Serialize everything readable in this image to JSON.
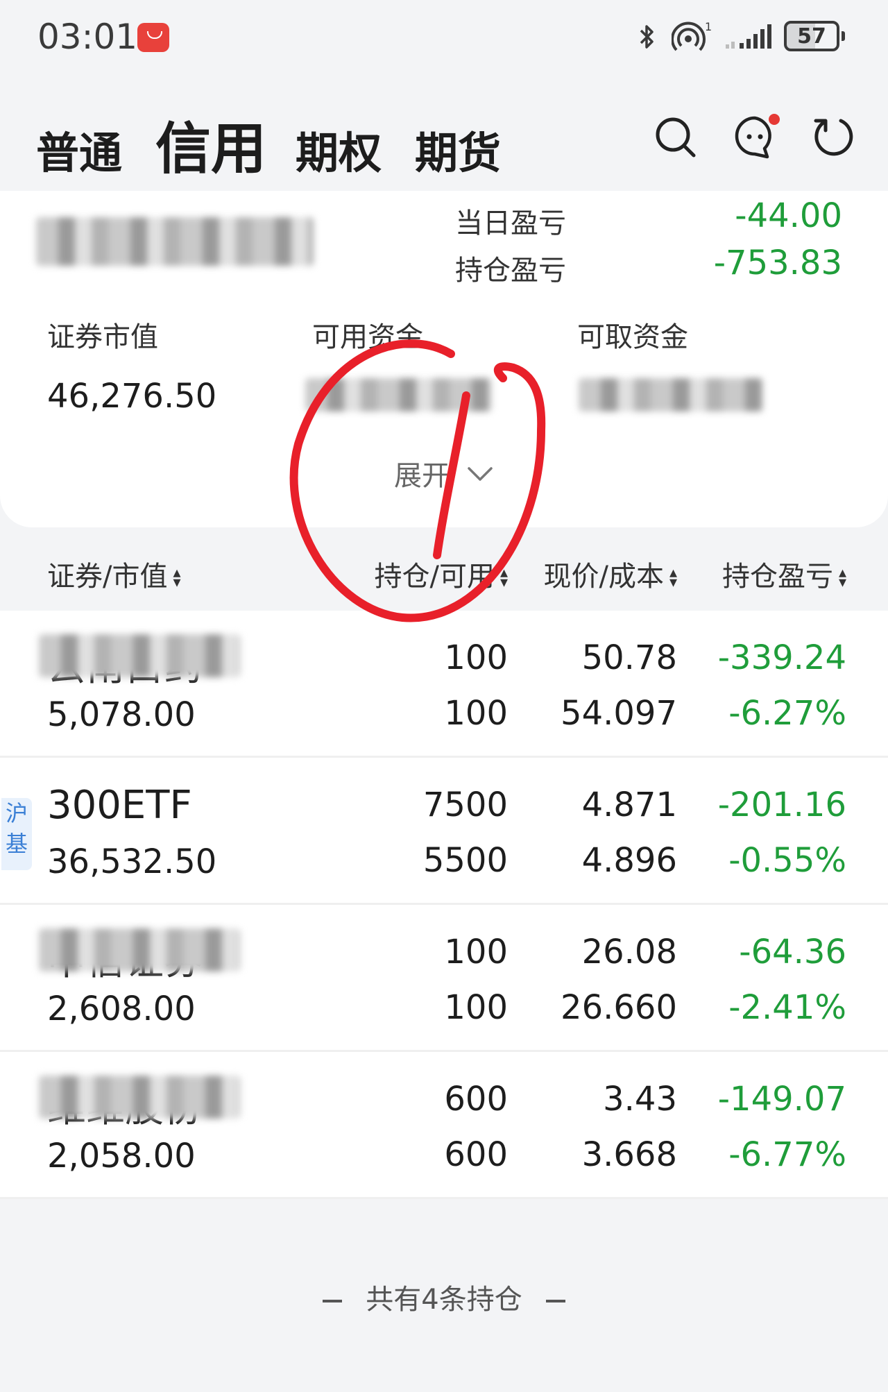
{
  "status_bar": {
    "time": "03:01",
    "battery": "57",
    "battery_level": 0.57
  },
  "nav": {
    "tabs": [
      {
        "label": "普通"
      },
      {
        "label": "信用"
      },
      {
        "label": "期权"
      },
      {
        "label": "期货"
      }
    ],
    "active_tab": "信用",
    "notification_dot_color": "#e53935"
  },
  "summary": {
    "day_pl_label": "当日盈亏",
    "day_pl_value": "-44.00",
    "hold_pl_label": "持仓盈亏",
    "hold_pl_value": "-753.83",
    "market_value_label": "证券市值",
    "market_value": "46,276.50",
    "available_cash_label": "可用资金",
    "withdrawable_cash_label": "可取资金",
    "expand_label": "展开"
  },
  "table": {
    "headers": [
      "证券/市值",
      "持仓/可用",
      "现价/成本",
      "持仓盈亏"
    ],
    "rows": [
      {
        "name": "云南白药",
        "name_blurred": true,
        "market_value": "5,078.00",
        "position": "100",
        "available": "100",
        "price": "50.78",
        "cost": "54.097",
        "pl": "-339.24",
        "pl_pct": "-6.27%"
      },
      {
        "name": "300ETF",
        "name_blurred": false,
        "badge": [
          "沪",
          "基"
        ],
        "market_value": "36,532.50",
        "position": "7500",
        "available": "5500",
        "price": "4.871",
        "cost": "4.896",
        "pl": "-201.16",
        "pl_pct": "-0.55%"
      },
      {
        "name": "中信证券",
        "name_blurred": true,
        "market_value": "2,608.00",
        "position": "100",
        "available": "100",
        "price": "26.08",
        "cost": "26.660",
        "pl": "-64.36",
        "pl_pct": "-2.41%"
      },
      {
        "name": "维维股份",
        "name_blurred": true,
        "market_value": "2,058.00",
        "position": "600",
        "available": "600",
        "price": "3.43",
        "cost": "3.668",
        "pl": "-149.07",
        "pl_pct": "-6.77%"
      }
    ]
  },
  "footer": {
    "text": "共有4条持仓"
  },
  "colors": {
    "loss_green": "#1f9d3a",
    "annotation_red": "#e8202a",
    "badge_blue": "#3a7fd5"
  }
}
